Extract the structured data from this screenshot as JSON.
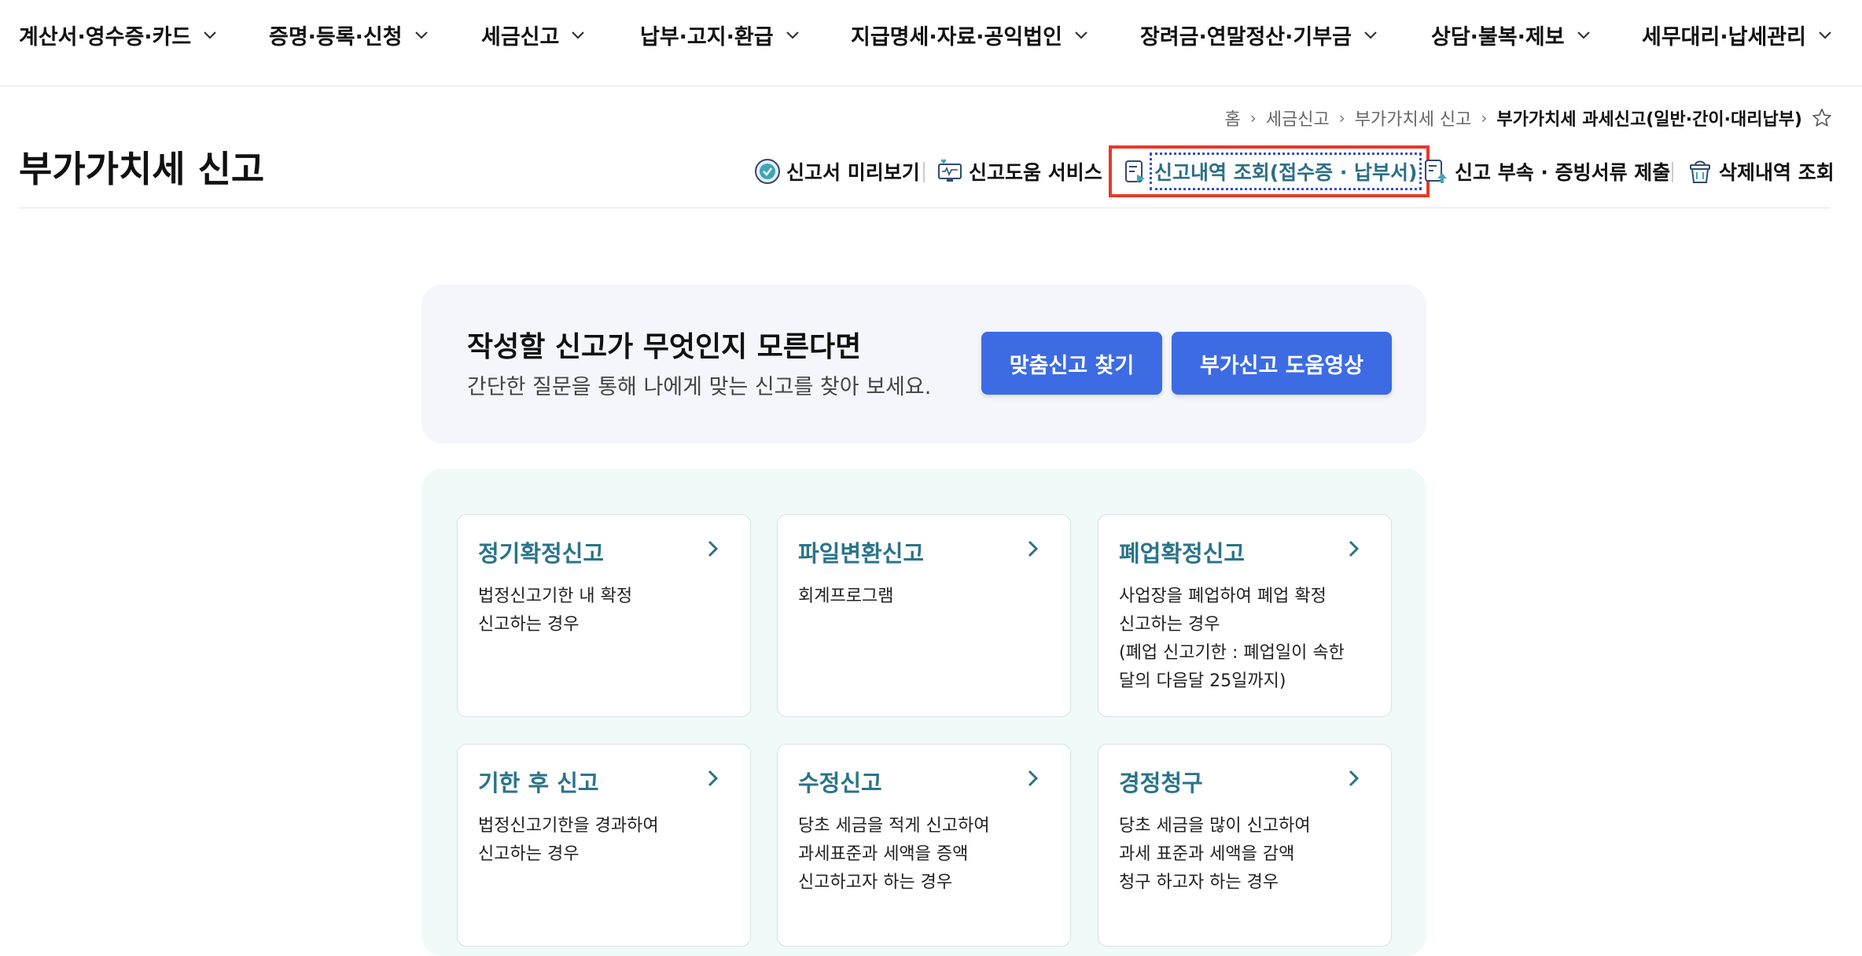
{
  "nav": {
    "items": [
      {
        "label": "계산서·영수증·카드"
      },
      {
        "label": "증명·등록·신청"
      },
      {
        "label": "세금신고"
      },
      {
        "label": "납부·고지·환급"
      },
      {
        "label": "지급명세·자료·공익법인"
      },
      {
        "label": "장려금·연말정산·기부금"
      },
      {
        "label": "상담·불복·제보"
      },
      {
        "label": "세무대리·납세관리"
      }
    ]
  },
  "breadcrumb": {
    "home": "홈",
    "level1": "세금신고",
    "level2": "부가가치세 신고",
    "current": "부가가치세 과세신고(일반·간이·대리납부)"
  },
  "page": {
    "title": "부가가치세 신고"
  },
  "actions": {
    "preview": "신고서 미리보기",
    "help_service": "신고도움 서비스",
    "history": "신고내역 조회(접수증 · 납부서)",
    "attach": "신고 부속 · 증빙서류 제출",
    "deleted": "삭제내역 조회"
  },
  "banner": {
    "title": "작성할 신고가 무엇인지 모른다면",
    "subtitle": "간단한 질문을 통해 나에게 맞는 신고를 찾아 보세요.",
    "find_button": "맞춤신고 찾기",
    "video_button": "부가신고 도움영상"
  },
  "cards": [
    {
      "title": "정기확정신고",
      "desc": [
        "법정신고기한 내 확정",
        "신고하는 경우"
      ]
    },
    {
      "title": "파일변환신고",
      "desc": [
        "회계프로그램"
      ]
    },
    {
      "title": "폐업확정신고",
      "desc": [
        "사업장을 폐업하여 폐업 확정",
        "신고하는 경우",
        "(폐업 신고기한 : 폐업일이 속한",
        "달의 다음달 25일까지)"
      ]
    },
    {
      "title": "기한 후 신고",
      "desc": [
        "법정신고기한을 경과하여",
        "신고하는 경우"
      ]
    },
    {
      "title": "수정신고",
      "desc": [
        "당초 세금을 적게 신고하여",
        "과세표준과 세액을 증액",
        "신고하고자 하는 경우"
      ]
    },
    {
      "title": "경정청구",
      "desc": [
        "당초 세금을 많이 신고하여",
        "과세 표준과 세액을 감액",
        "청구 하고자 하는 경우"
      ]
    }
  ],
  "colors": {
    "primary_button": "#3d6be3",
    "card_title": "#2a7489",
    "highlight_box": "#e53a2a",
    "banner_bg": "#f4f6fb",
    "cards_bg": "#f0faf8"
  }
}
